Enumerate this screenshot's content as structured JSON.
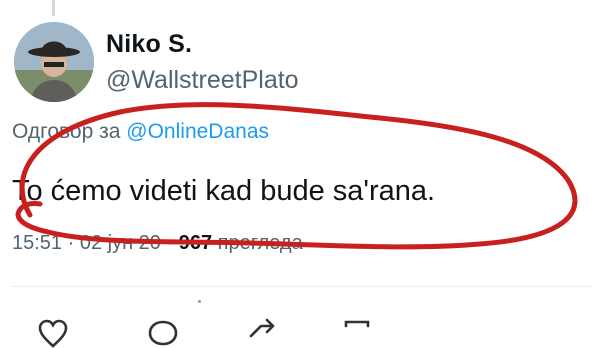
{
  "tweet": {
    "display_name": "Niko S.",
    "handle": "@WallstreetPlato",
    "reply_prefix": "Одговор за",
    "reply_mention": "@OnlineDanas",
    "text": "To ćemo videti kad bude sa'rana.",
    "timestamp": "15:51 · 02 јун 20",
    "separator": " · ",
    "view_count": "967",
    "view_label": "прегледа"
  },
  "icons": {
    "reply": "reply-icon",
    "retweet": "retweet-icon",
    "like": "like-icon",
    "share": "share-icon",
    "bookmark": "bookmark-icon"
  },
  "colors": {
    "mention": "#1d9bf0",
    "secondary_text": "#536471",
    "annotation_red": "#c8201e"
  }
}
